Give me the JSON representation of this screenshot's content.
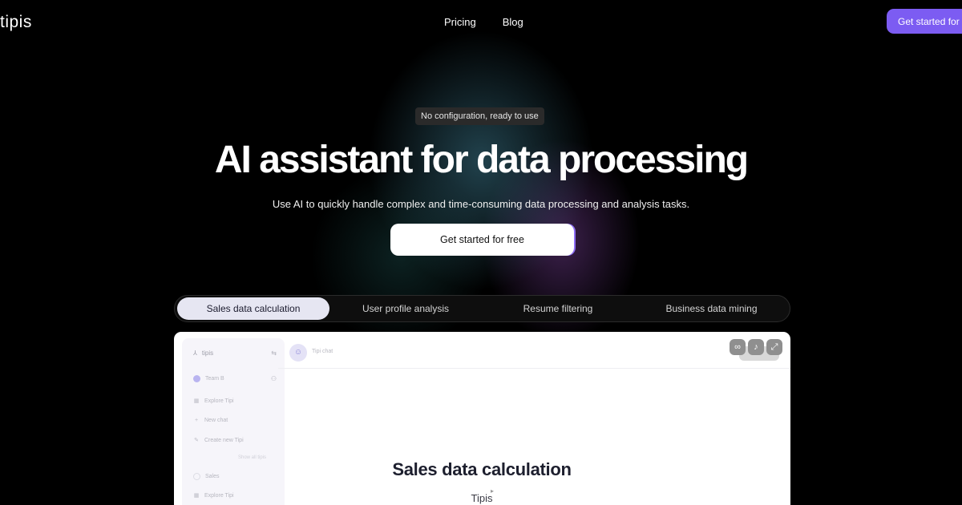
{
  "nav": {
    "logo": "tipis",
    "links": [
      "Pricing",
      "Blog"
    ],
    "cta": "Get started for free"
  },
  "hero": {
    "badge": "No configuration, ready to use",
    "title": "AI assistant for data processing",
    "subtitle": "Use AI to quickly handle complex and time-consuming data processing and analysis tasks.",
    "cta": "Get started for free"
  },
  "tabs": [
    {
      "label": "Sales data calculation",
      "active": true
    },
    {
      "label": "User profile analysis",
      "active": false
    },
    {
      "label": "Resume filtering",
      "active": false
    },
    {
      "label": "Business data mining",
      "active": false
    }
  ],
  "preview": {
    "sidebar": {
      "brand": "tipis",
      "team": "Team B",
      "items": [
        "Explore Tipi",
        "New chat",
        "Create new Tipi"
      ],
      "section_hint": "Show all tipis",
      "list": [
        "Sales",
        "Explore Tipi"
      ]
    },
    "chat": {
      "name": "Tipi chat"
    },
    "controls": [
      "link-icon",
      "volume-icon",
      "expand-icon"
    ],
    "card_title": "Sales data calculation",
    "card_subtitle": "Tipis"
  },
  "colors": {
    "accent": "#7c5cf2",
    "background": "#000000",
    "active_tab": "#e6e6f2"
  }
}
